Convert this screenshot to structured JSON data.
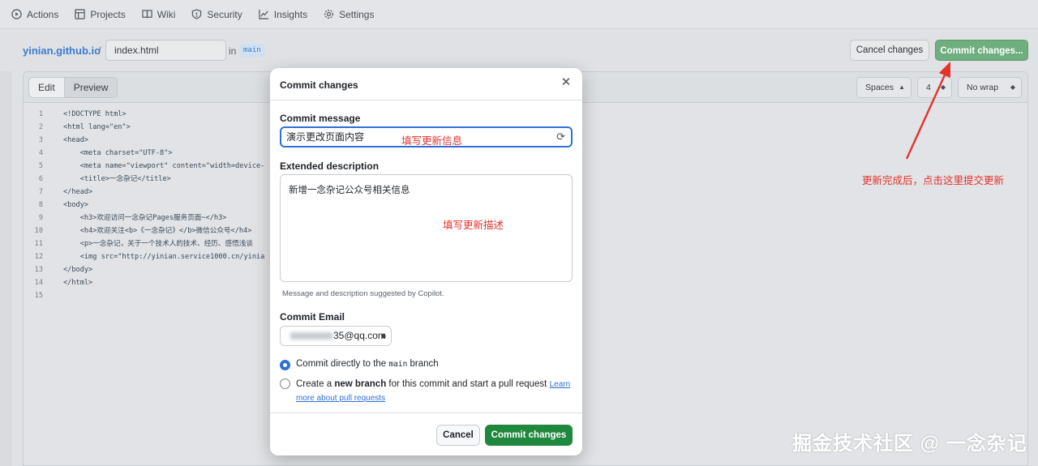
{
  "nav": {
    "items": [
      {
        "label": "Actions",
        "icon": "play-circle-icon"
      },
      {
        "label": "Projects",
        "icon": "table-icon"
      },
      {
        "label": "Wiki",
        "icon": "book-icon"
      },
      {
        "label": "Security",
        "icon": "shield-icon"
      },
      {
        "label": "Insights",
        "icon": "graph-icon"
      },
      {
        "label": "Settings",
        "icon": "gear-icon"
      }
    ]
  },
  "file_header": {
    "repo": "yinian.github.io",
    "slash": "/",
    "filename": "index.html",
    "in_label": "in",
    "branch": "main",
    "cancel_label": "Cancel changes",
    "commit_label": "Commit changes..."
  },
  "editor": {
    "tab_edit": "Edit",
    "tab_preview": "Preview",
    "indent_mode": "Spaces",
    "indent_size": "4",
    "wrap_mode": "No wrap",
    "lines": [
      {
        "n": "1",
        "text": "<!DOCTYPE html>"
      },
      {
        "n": "2",
        "text": "<html lang=\"en\">"
      },
      {
        "n": "3",
        "text": "<head>"
      },
      {
        "n": "4",
        "text": "    <meta charset=\"UTF-8\">"
      },
      {
        "n": "5",
        "text": "    <meta name=\"viewport\" content=\"width=device-"
      },
      {
        "n": "6",
        "text": "    <title>一念杂记</title>"
      },
      {
        "n": "7",
        "text": "</head>"
      },
      {
        "n": "8",
        "text": "<body>"
      },
      {
        "n": "9",
        "text": "    <h3>欢迎访问一念杂记Pages服务页面~</h3>"
      },
      {
        "n": "10",
        "text": "    <h4>欢迎关注<b>《一念杂记》</b>微信公众号</h4>"
      },
      {
        "n": "11",
        "text": "    <p>一念杂记，关于一个技术人的技术、经历、感悟浅谈"
      },
      {
        "n": "12",
        "text": "    <img src=\"http://yinian.service1000.cn/yinia"
      },
      {
        "n": "13",
        "text": "</body>"
      },
      {
        "n": "14",
        "text": "</html>"
      },
      {
        "n": "15",
        "text": ""
      }
    ]
  },
  "modal": {
    "title": "Commit changes",
    "message_label": "Commit message",
    "message_value": "演示更改页面内容",
    "message_annotation": "填写更新信息",
    "description_label": "Extended description",
    "description_value": "新增一念杂记公众号相关信息",
    "description_annotation": "填写更新描述",
    "hint": "Message and description suggested by Copilot.",
    "email_label": "Commit Email",
    "email_value_visible": "35@qq.com",
    "radio_direct_prefix": "Commit directly to the",
    "radio_direct_branch": "main",
    "radio_direct_suffix": "branch",
    "radio_new_prefix": "Create a",
    "radio_new_bold": "new branch",
    "radio_new_suffix": "for this commit and start a pull request",
    "radio_new_link_1": "Learn",
    "radio_new_link_2": "more about pull requests",
    "cancel": "Cancel",
    "commit": "Commit changes"
  },
  "annotations": {
    "arrow_text": "更新完成后，点击这里提交更新",
    "watermark": "掘金技术社区 @ 一念杂记"
  },
  "colors": {
    "accent_blue": "#2f6fd6",
    "commit_green": "#1f883d",
    "annotation_red": "#e5322d"
  }
}
